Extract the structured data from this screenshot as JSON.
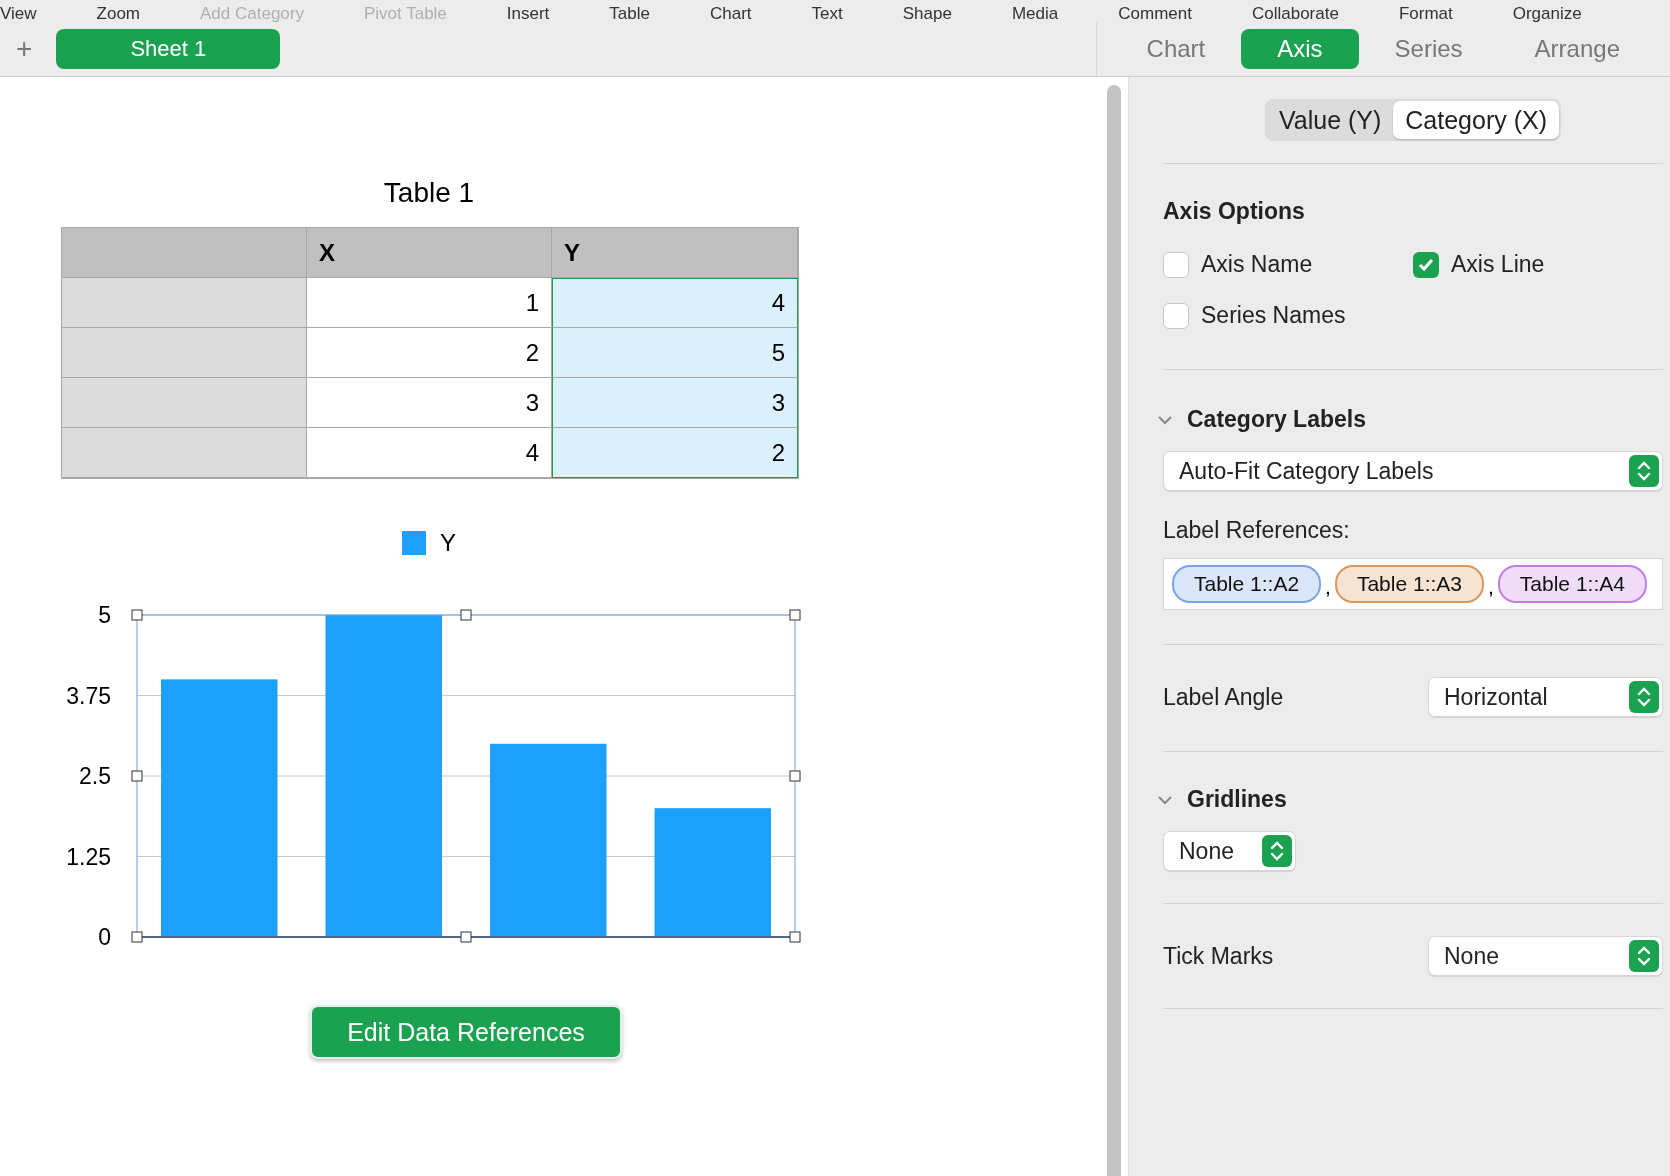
{
  "menu_bar": [
    {
      "label": "View",
      "disabled": false
    },
    {
      "label": "Zoom",
      "disabled": false
    },
    {
      "label": "Add Category",
      "disabled": true
    },
    {
      "label": "Pivot Table",
      "disabled": true
    },
    {
      "label": "Insert",
      "disabled": false
    },
    {
      "label": "Table",
      "disabled": false
    },
    {
      "label": "Chart",
      "disabled": false
    },
    {
      "label": "Text",
      "disabled": false
    },
    {
      "label": "Shape",
      "disabled": false
    },
    {
      "label": "Media",
      "disabled": false
    },
    {
      "label": "Comment",
      "disabled": false
    },
    {
      "label": "Collaborate",
      "disabled": false
    },
    {
      "label": "Format",
      "disabled": false
    },
    {
      "label": "Organize",
      "disabled": false
    }
  ],
  "sheet_bar": {
    "add": "+",
    "sheets": [
      {
        "label": "Sheet 1",
        "selected": true
      }
    ]
  },
  "inspector_tabs": [
    {
      "label": "Chart",
      "selected": false
    },
    {
      "label": "Axis",
      "selected": true
    },
    {
      "label": "Series",
      "selected": false
    },
    {
      "label": "Arrange",
      "selected": false
    }
  ],
  "table": {
    "title": "Table 1",
    "columns": [
      "",
      "X",
      "Y"
    ],
    "rows": [
      [
        "",
        "1",
        "4"
      ],
      [
        "",
        "2",
        "5"
      ],
      [
        "",
        "3",
        "3"
      ],
      [
        "",
        "4",
        "2"
      ]
    ]
  },
  "chart": {
    "chart_data": {
      "type": "bar",
      "grid": true,
      "series": [
        {
          "name": "Y",
          "color": "#1ca0fb",
          "values": [
            4,
            5,
            3,
            2
          ]
        }
      ],
      "ylim": [
        0,
        5
      ],
      "yticks": [
        0,
        {
          "value": 1.25,
          "label": "1.25"
        },
        {
          "value": 2.5,
          "label": "2.5"
        },
        {
          "value": 3.75,
          "label": "3.75"
        },
        5
      ]
    },
    "button": "Edit Data References"
  },
  "axis_segments": [
    {
      "label": "Value (Y)",
      "selected": false
    },
    {
      "label": "Category (X)",
      "selected": true
    }
  ],
  "axis_options": {
    "title": "Axis Options",
    "checkboxes": [
      {
        "label": "Axis Name",
        "checked": false
      },
      {
        "label": "Axis Line",
        "checked": true
      },
      {
        "label": "Series Names",
        "checked": false
      }
    ]
  },
  "category_labels": {
    "title": "Category Labels",
    "expanded": true,
    "popup": "Auto-Fit Category Labels",
    "references_label": "Label References:",
    "references": [
      {
        "label": "Table 1::A2",
        "color": "#7aa3e8"
      },
      {
        "label": "Table 1::A3",
        "color": "#d9975a"
      },
      {
        "label": "Table 1::A4",
        "color": "#c37ee0"
      }
    ],
    "separator": ","
  },
  "label_angle": {
    "label": "Label Angle",
    "value": "Horizontal"
  },
  "gridlines": {
    "title": "Gridlines",
    "expanded": true,
    "value": "None"
  },
  "tick_marks": {
    "label": "Tick Marks",
    "value": "None"
  }
}
